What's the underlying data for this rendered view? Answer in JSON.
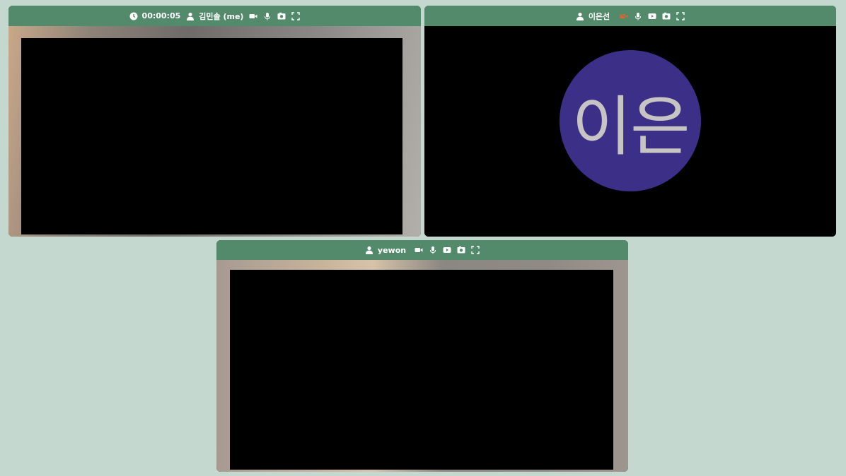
{
  "tiles": [
    {
      "timer": "00:00:05",
      "name": "김민솔 (me)",
      "camera": "on",
      "icons": [
        "clock-icon",
        "user-icon",
        "camera-icon",
        "mic-icon",
        "screen-share-icon",
        "record-icon",
        "fullscreen-icon"
      ]
    },
    {
      "name": "이은선",
      "camera": "off",
      "avatar_text": "이은",
      "avatar_color": "#3b2f88",
      "icons": [
        "user-icon",
        "camera-off-icon",
        "mic-icon",
        "youtube-icon",
        "record-icon",
        "fullscreen-icon"
      ]
    },
    {
      "name": "yewon",
      "camera": "on",
      "icons": [
        "user-icon",
        "camera-icon",
        "mic-icon",
        "youtube-icon",
        "record-icon",
        "fullscreen-icon"
      ]
    }
  ],
  "colors": {
    "background": "#c5d8cf",
    "tile_bar": "#528a6b",
    "camera_off": "#e0622f"
  }
}
